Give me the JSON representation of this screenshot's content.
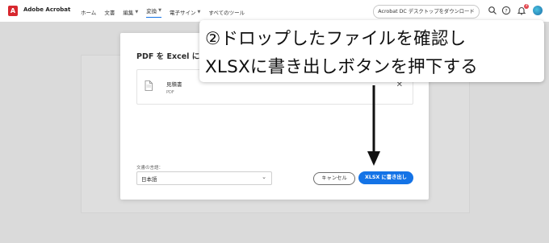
{
  "header": {
    "logo_text": "A",
    "app_name": "Adobe Acrobat",
    "nav": [
      {
        "label": "ホーム",
        "has_menu": false,
        "active": false
      },
      {
        "label": "文書",
        "has_menu": false,
        "active": false
      },
      {
        "label": "編集",
        "has_menu": true,
        "active": false
      },
      {
        "label": "変換",
        "has_menu": true,
        "active": true
      },
      {
        "label": "電子サイン",
        "has_menu": true,
        "active": false
      },
      {
        "label": "すべてのツール",
        "has_menu": false,
        "active": false
      }
    ],
    "download_label": "Acrobat DC デスクトップをダウンロード",
    "notification_count": "3",
    "icons": [
      "search-icon",
      "help-icon",
      "bell-icon",
      "avatar"
    ]
  },
  "dialog": {
    "title": "PDF を Excel に",
    "file": {
      "name": "見積書",
      "type": "PDF"
    },
    "language_label": "文書の言語：",
    "language_value": "日本語",
    "cancel_label": "キャンセル",
    "export_label": "XLSX に書き出し"
  },
  "callout": {
    "line1": "②ドロップしたファイルを確認し",
    "line2": "XLSXに書き出しボタンを押下する"
  },
  "colors": {
    "accent": "#1473e6",
    "acrobat_red": "#d7282f",
    "badge": "#e34850"
  }
}
